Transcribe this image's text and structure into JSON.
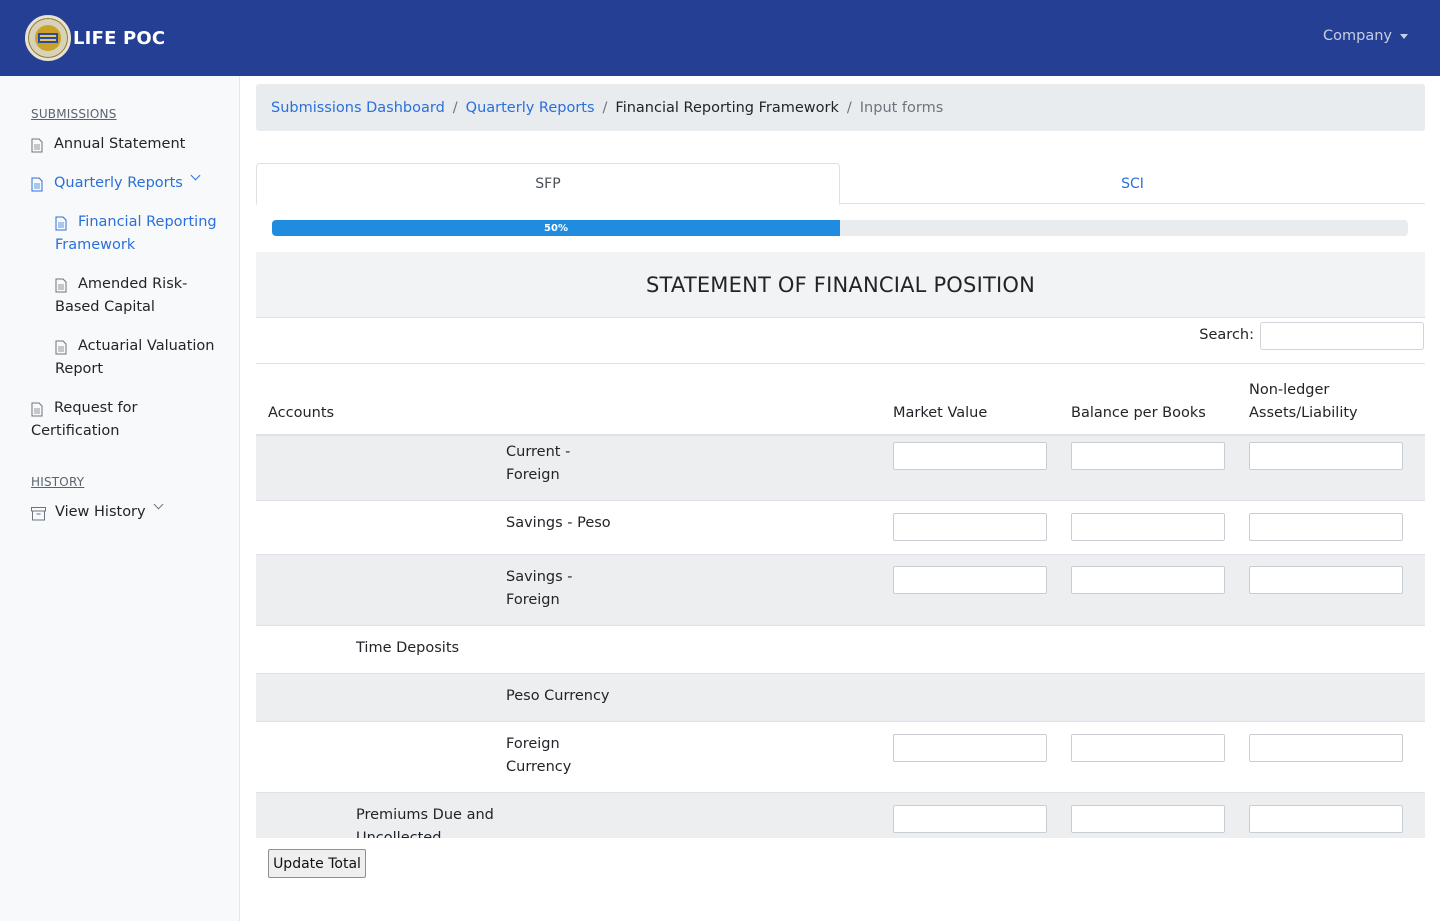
{
  "navbar": {
    "brand": "LIFE POC",
    "company_menu": "Company"
  },
  "sidebar": {
    "submissions_heading": "SUBMISSIONS",
    "history_heading": "HISTORY",
    "items": [
      {
        "label": "Annual Statement",
        "icon": "document-icon"
      },
      {
        "label": "Quarterly Reports",
        "icon": "document-icon",
        "active": true
      },
      {
        "label": "Financial Reporting Framework",
        "icon": "document-icon",
        "active": true
      },
      {
        "label": "Amended Risk-Based Capital",
        "icon": "document-icon"
      },
      {
        "label": "Actuarial Valuation Report",
        "icon": "document-icon"
      },
      {
        "label": "Request for Certification",
        "icon": "document-icon"
      },
      {
        "label": "View History",
        "icon": "archive-icon"
      }
    ],
    "sub_lines": {
      "frf_1": "Financial Reporting",
      "frf_2": "Framework",
      "arbc_1": "Amended Risk-",
      "arbc_2": "Based Capital",
      "avr_1": "Actuarial Valuation",
      "avr_2": "Report",
      "rfc_1": "Request for",
      "rfc_2": "Certification"
    }
  },
  "breadcrumb": {
    "items": [
      "Submissions Dashboard",
      "Quarterly Reports",
      "Financial Reporting Framework",
      "Input forms"
    ]
  },
  "tabs": [
    "SFP",
    "SCI"
  ],
  "progress": {
    "label": "50%",
    "value": 50
  },
  "form": {
    "title": "STATEMENT OF FINANCIAL POSITION",
    "search_label": "Search:",
    "search_value": "",
    "columns": {
      "accounts": "Accounts",
      "market_value": "Market Value",
      "balance_per_books": "Balance per Books",
      "non_ledger_1": "Non-ledger",
      "non_ledger_2": "Assets/Liability"
    },
    "rows": [
      {
        "label_1": "Current -",
        "label_2": "Foreign",
        "inputs": true
      },
      {
        "label_1": "Savings - Peso",
        "label_2": "",
        "inputs": true
      },
      {
        "label_1": "Savings -",
        "label_2": "Foreign",
        "inputs": true
      },
      {
        "label_1": "Time Deposits",
        "label_2": "",
        "inputs": false
      },
      {
        "label_1": "Peso Currency",
        "label_2": "",
        "inputs": false
      },
      {
        "label_1": "Foreign",
        "label_2": "Currency",
        "inputs": true
      },
      {
        "label_1": "Premiums Due and",
        "label_2": "Uncollected",
        "inputs": true
      }
    ]
  },
  "update_button": "Update Total",
  "colors": {
    "navbar": "#243f94",
    "link": "#2a6fdb",
    "progress": "#1f8ce0"
  }
}
